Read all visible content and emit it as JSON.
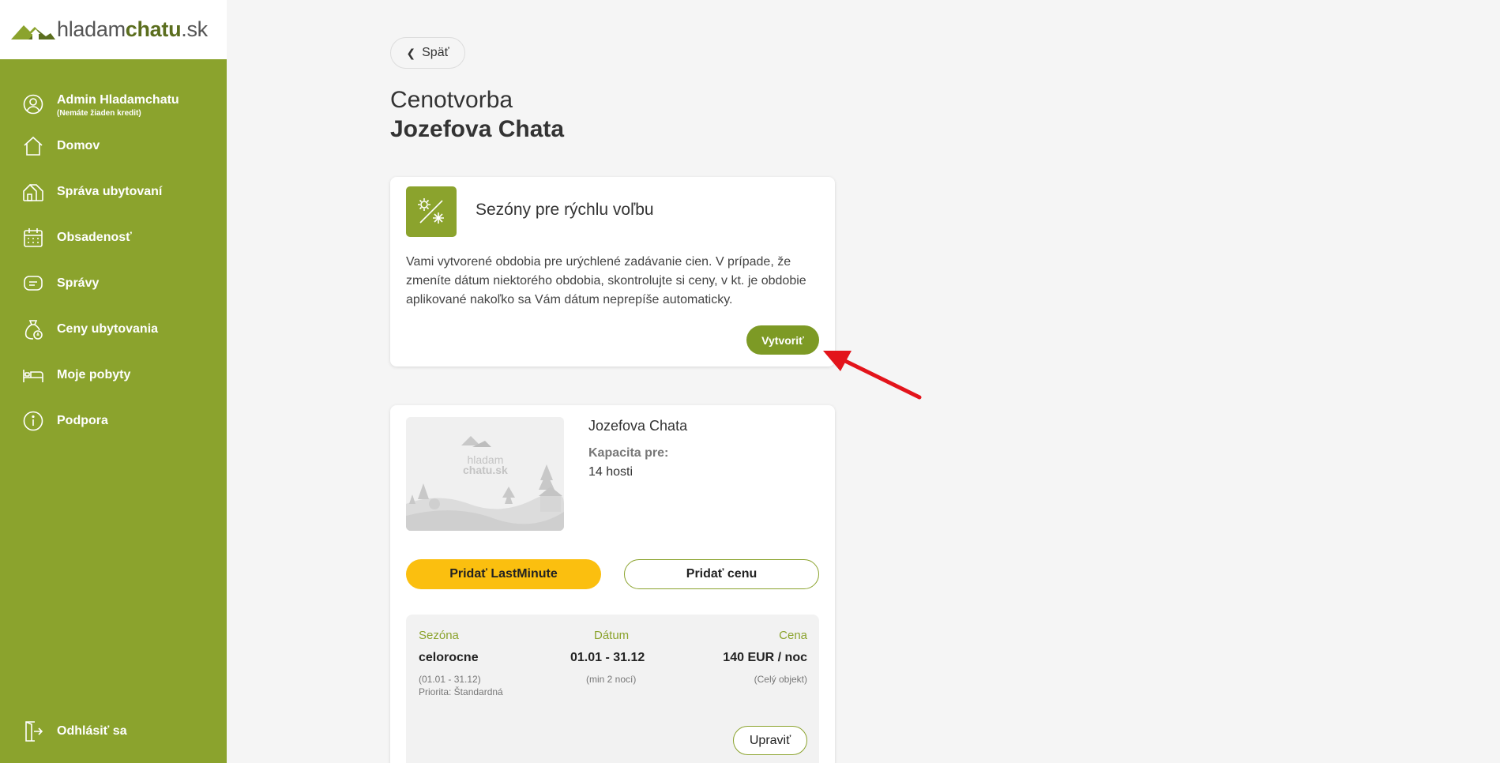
{
  "brand": {
    "name_part1": "hladam",
    "name_part2": "chatu",
    "name_tld": ".sk",
    "accent": "#8ba32d"
  },
  "sidebar": {
    "user": {
      "name": "Admin Hladamchatu",
      "credit": "(Nemáte žiaden kredit)"
    },
    "items": [
      {
        "label": "Domov",
        "icon": "home-icon"
      },
      {
        "label": "Správa ubytovaní",
        "icon": "houses-icon"
      },
      {
        "label": "Obsadenosť",
        "icon": "calendar-icon"
      },
      {
        "label": "Správy",
        "icon": "message-icon"
      },
      {
        "label": "Ceny ubytovania",
        "icon": "money-bag-icon"
      },
      {
        "label": "Moje pobyty",
        "icon": "bed-icon"
      },
      {
        "label": "Podpora",
        "icon": "info-icon"
      }
    ],
    "logout": "Odhlásiť sa"
  },
  "main": {
    "back_label": "Späť",
    "title": "Cenotvorba",
    "subtitle": "Jozefova Chata",
    "seasons_card": {
      "title": "Sezóny pre rýchlu voľbu",
      "text": "Vami vytvorené obdobia pre urýchlené zadávanie cien. V prípade, že zmeníte dátum niektorého obdobia, skontrolujte si ceny, v kt. je obdobie aplikované nakoľko sa Vám dátum neprepíše automaticky.",
      "create_label": "Vytvoriť"
    },
    "property": {
      "name": "Jozefova Chata",
      "capacity_label": "Kapacita pre:",
      "capacity_value": "14  hosti",
      "placeholder_logo_1": "hladam",
      "placeholder_logo_2": "chatu.sk",
      "lastminute_label": "Pridať LastMinute",
      "add_price_label": "Pridať cenu",
      "price_table": {
        "headers": {
          "season": "Sezóna",
          "date": "Dátum",
          "price": "Cena"
        },
        "row": {
          "season": "celorocne",
          "season_range": "(01.01  -  31.12)",
          "priority": "Priorita: Štandardná",
          "date": "01.01  -  31.12",
          "min_nights": "(min 2 nocí)",
          "price": "140 EUR / noc",
          "price_scope": "(Celý objekt)"
        },
        "edit_label": "Upraviť"
      }
    }
  }
}
